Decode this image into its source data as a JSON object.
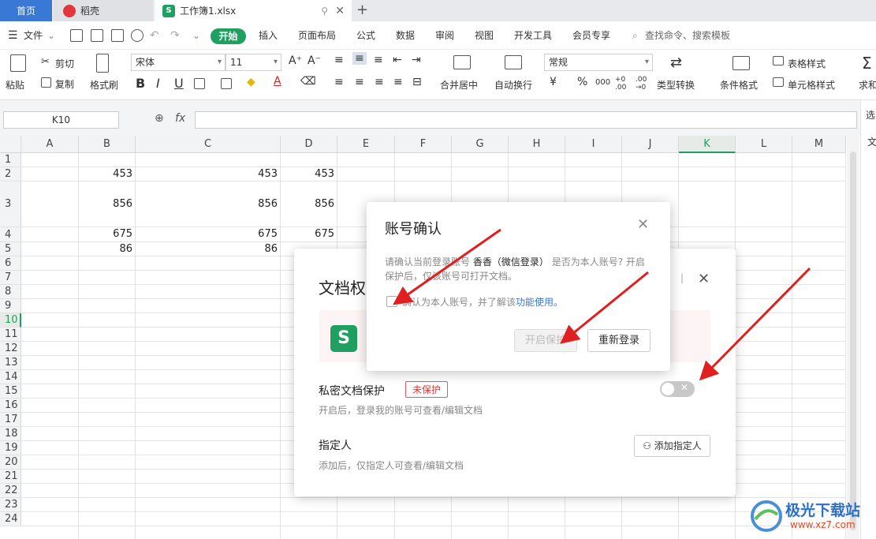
{
  "tabs": {
    "home": "首页",
    "daoke": "稻壳",
    "workbook": "工作簿1.xlsx"
  },
  "menu": {
    "file": "文件",
    "start": "开始",
    "items": [
      "插入",
      "页面布局",
      "公式",
      "数据",
      "审阅",
      "视图",
      "开发工具",
      "会员专享"
    ],
    "search": "查找命令、搜索模板"
  },
  "ribbon": {
    "paste": "粘贴",
    "cut": "剪切",
    "copy": "复制",
    "format_painter": "格式刷",
    "font_name": "宋体",
    "font_size": "11",
    "bold": "B",
    "italic": "I",
    "underline": "U",
    "merge": "合并居中",
    "wrap": "自动换行",
    "number_format": "常规",
    "type_convert": "类型转换",
    "cond_format": "条件格式",
    "table_style": "表格样式",
    "cell_style": "单元格样式",
    "sum": "求和",
    "currency": "¥",
    "percent": "%"
  },
  "formula_bar": {
    "cell_ref": "K10",
    "fx": "fx"
  },
  "sheet": {
    "columns": [
      "A",
      "B",
      "C",
      "D",
      "E",
      "F",
      "G",
      "H",
      "I",
      "J",
      "K",
      "L",
      "M"
    ],
    "rows": [
      "1",
      "2",
      "3",
      "4",
      "5",
      "6",
      "7",
      "8",
      "9",
      "10",
      "11",
      "12",
      "13",
      "14",
      "15",
      "16",
      "17",
      "18",
      "19",
      "20",
      "21",
      "22",
      "23",
      "24"
    ],
    "r2": [
      "453",
      "453",
      "453"
    ],
    "r3": [
      "856",
      "856",
      "856"
    ],
    "r4": [
      "675",
      "675",
      "675"
    ],
    "r5": [
      "86",
      "86"
    ],
    "side_label": "选",
    "side_label2": "文"
  },
  "doc_permission_dialog": {
    "title": "文档权",
    "private_label": "私密文档保护",
    "private_badge": "未保护",
    "private_desc": "开启后，登录我的账号可查看/编辑文档",
    "toggle_symbol": "✕",
    "assign_label": "指定人",
    "assign_desc": "添加后，仅指定人可查看/编辑文档",
    "add_button": "添加指定人"
  },
  "account_dialog": {
    "title": "账号确认",
    "desc_prefix": "请确认当前登录账号",
    "account_name": "香香（微信登录）",
    "desc_suffix": "是否为本人账号? 开启保护后，仅该账号可打开文档。",
    "checkbox_label": "确认为本人账号，并了解该",
    "link": "功能使用。",
    "enable_button": "开启保护",
    "relogin_button": "重新登录"
  },
  "watermark": {
    "name": "极光下载站",
    "url": "www.xz7.com"
  }
}
